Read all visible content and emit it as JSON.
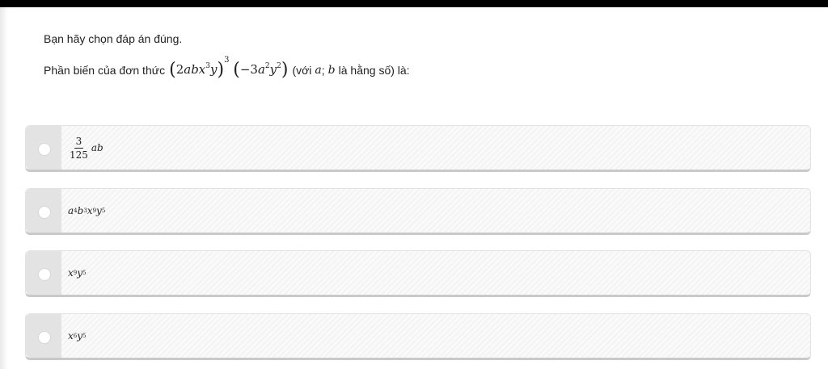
{
  "instruction": "Bạn hãy chọn đáp án đúng.",
  "question": {
    "prefix": "Phần biến của đơn thức",
    "note_open": "(với",
    "var_a": "a",
    "semicolon": ";",
    "var_b": "b",
    "note_close": "là hằng số) là:"
  },
  "options": [
    {
      "id": "A",
      "numerator": "3",
      "denominator": "125",
      "suffix": "ab"
    },
    {
      "id": "B",
      "parts": [
        [
          "a",
          "4"
        ],
        [
          "b",
          "3"
        ],
        [
          "x",
          "9"
        ],
        [
          "y",
          "5"
        ]
      ]
    },
    {
      "id": "C",
      "parts": [
        [
          "x",
          "9"
        ],
        [
          "y",
          "5"
        ]
      ]
    },
    {
      "id": "D",
      "parts": [
        [
          "x",
          "6"
        ],
        [
          "y",
          "5"
        ]
      ]
    }
  ]
}
